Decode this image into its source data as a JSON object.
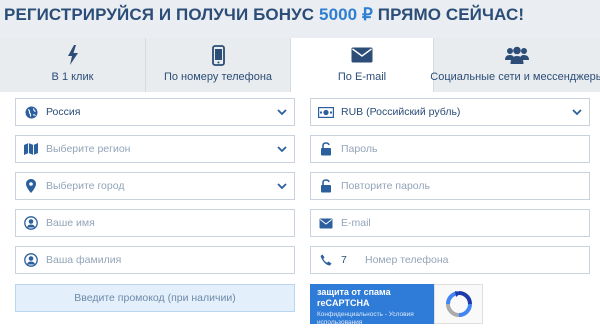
{
  "header": {
    "title_main": "РЕГИСТРИРУЙСЯ И ПОЛУЧИ БОНУС ",
    "title_bonus": "5000 ₽",
    "title_tail": " ПРЯМО СЕЙЧАС!"
  },
  "tabs": [
    {
      "label": "В 1 клик",
      "icon": "lightning-icon"
    },
    {
      "label": "По номеру телефона",
      "icon": "phone-icon"
    },
    {
      "label": "По E-mail",
      "icon": "envelope-icon",
      "active": true
    },
    {
      "label": "Социальные сети и мессенджеры",
      "icon": "users-icon"
    }
  ],
  "form": {
    "country": {
      "value": "Россия",
      "icon": "globe-icon"
    },
    "region": {
      "placeholder": "Выберите регион",
      "icon": "map-icon"
    },
    "city": {
      "placeholder": "Выберите город",
      "icon": "location-pin-icon"
    },
    "first_name": {
      "placeholder": "Ваше имя",
      "icon": "user-icon"
    },
    "last_name": {
      "placeholder": "Ваша фамилия",
      "icon": "user-icon"
    },
    "currency": {
      "value": "RUB (Российский рубль)",
      "icon": "money-icon"
    },
    "password": {
      "placeholder": "Пароль",
      "icon": "lock-icon"
    },
    "password_repeat": {
      "placeholder": "Повторите пароль",
      "icon": "lock-icon"
    },
    "email": {
      "placeholder": "E-mail",
      "icon": "envelope-icon"
    },
    "phone": {
      "code": "7",
      "placeholder": "Номер телефона",
      "icon": "phone-handset-icon"
    },
    "promo": {
      "placeholder": "Введите промокод (при наличии)"
    }
  },
  "captcha": {
    "title": "защита от спама reCAPTCHA",
    "subtitle": "Конфиденциальность - Условия использования"
  },
  "colors": {
    "brand_dark": "#2b4d77",
    "accent": "#2e7fd0",
    "icon": "#2b5f9e",
    "page_bg": "#eaeef2",
    "promo_bg": "#e3f0fc"
  }
}
